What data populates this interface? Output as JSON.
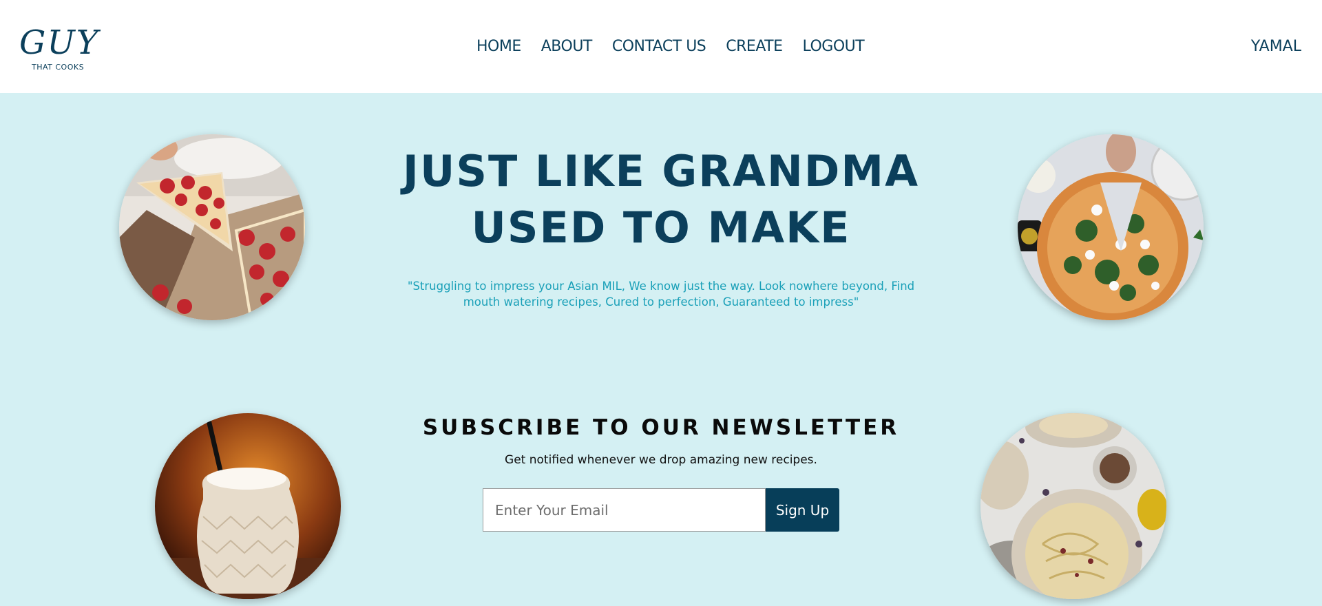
{
  "header": {
    "logo_script": "GUY",
    "logo_sub": "THAT COOKS",
    "nav": [
      "HOME",
      "ABOUT",
      "CONTACT US",
      "CREATE",
      "LOGOUT"
    ],
    "user": "YAMAL"
  },
  "hero": {
    "title_line1": "JUST LIKE GRANDMA",
    "title_line2": "USED TO MAKE",
    "quote": "\"Struggling to impress your Asian MIL, We know just the way. Look nowhere beyond, Find mouth watering recipes, Cured to perfection, Guaranteed to impress\""
  },
  "newsletter": {
    "title": "SUBSCRIBE TO OUR NEWSLETTER",
    "subtitle": "Get notified whenever we drop amazing new recipes.",
    "email_placeholder": "Enter Your Email",
    "email_value": "",
    "button_label": "Sign Up"
  },
  "images": [
    {
      "name": "pepperoni-pizza-image"
    },
    {
      "name": "spinach-pizza-image"
    },
    {
      "name": "milkshake-image"
    },
    {
      "name": "pasta-table-image"
    }
  ],
  "colors": {
    "background": "#d4f0f3",
    "brand_navy": "#0b3f5b",
    "quote_teal": "#1aa0b8",
    "button": "#073e59"
  }
}
